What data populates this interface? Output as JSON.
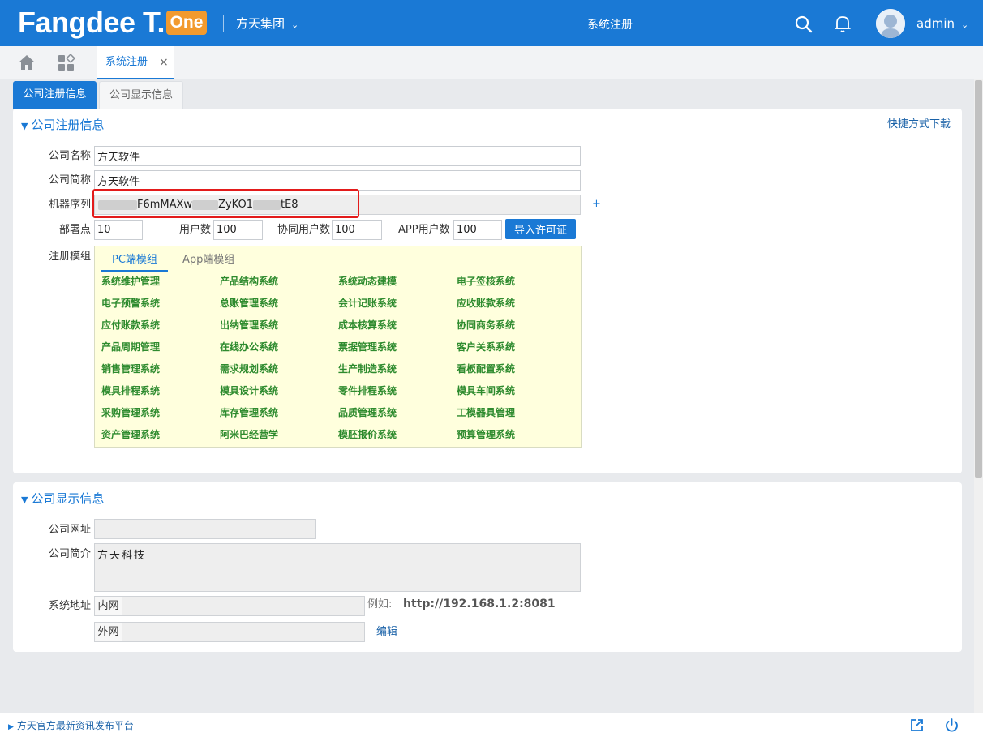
{
  "header": {
    "logo_text": "Fangdee T.",
    "logo_badge": "One",
    "company_name": "方天集团",
    "search_value": "系统注册",
    "username": "admin",
    "icons": [
      "search-icon",
      "bell-icon",
      "avatar",
      "chevron-down-icon"
    ]
  },
  "tabbar": {
    "active_tab_label": "系统注册",
    "close_glyph": "×",
    "icons": [
      "home-icon",
      "apps-icon"
    ]
  },
  "subtabs": [
    "公司注册信息",
    "公司显示信息"
  ],
  "registration": {
    "section_title": "公司注册信息",
    "shortcut_link": "快捷方式下载",
    "company_name_label": "公司名称",
    "company_name_value": "方天软件",
    "company_short_label": "公司简称",
    "company_short_value": "方天软件",
    "machine_serial_label": "机器序列",
    "machine_serial_parts": [
      "F6mMAXw",
      "ZyKO1",
      "tE8"
    ],
    "add_glyph": "+",
    "deploy_label": "部署点",
    "deploy_value": "10",
    "users_label": "用户数",
    "users_value": "100",
    "collab_label": "协同用户数",
    "collab_value": "100",
    "app_users_label": "APP用户数",
    "app_users_value": "100",
    "import_button": "导入许可证",
    "modules_label": "注册模组",
    "module_tabs": [
      "PC端模组",
      "App端模组"
    ],
    "modules": [
      "系统维护管理",
      "产品结构系统",
      "系统动态建模",
      "电子签核系统",
      "电子预警系统",
      "总账管理系统",
      "会计记账系统",
      "应收账款系统",
      "应付账款系统",
      "出纳管理系统",
      "成本核算系统",
      "协同商务系统",
      "产品周期管理",
      "在线办公系统",
      "票据管理系统",
      "客户关系系统",
      "销售管理系统",
      "需求规划系统",
      "生产制造系统",
      "看板配置系统",
      "模具排程系统",
      "模具设计系统",
      "零件排程系统",
      "模具车间系统",
      "采购管理系统",
      "库存管理系统",
      "品质管理系统",
      "工模器具管理",
      "资产管理系统",
      "阿米巴经营学",
      "模胚报价系统",
      "预算管理系统"
    ]
  },
  "display": {
    "section_title": "公司显示信息",
    "website_label": "公司网址",
    "website_value": "",
    "intro_label": "公司简介",
    "intro_value": "方天科技",
    "address_label": "系统地址",
    "intranet_prefix": "内网",
    "intranet_value": "",
    "example_label": "例如:",
    "example_value": "http://192.168.1.2:8081",
    "extranet_prefix": "外网",
    "extranet_value": "",
    "edit_link": "编辑"
  },
  "footer": {
    "news_link": "方天官方最新资讯发布平台",
    "icons": [
      "export-icon",
      "power-icon"
    ]
  },
  "colors": {
    "primary": "#1a79d5",
    "brand_badge": "#f29a2e",
    "module_text": "#2e8b2e",
    "module_bg": "#ffffdd",
    "highlight_box": "#e31b1b"
  }
}
